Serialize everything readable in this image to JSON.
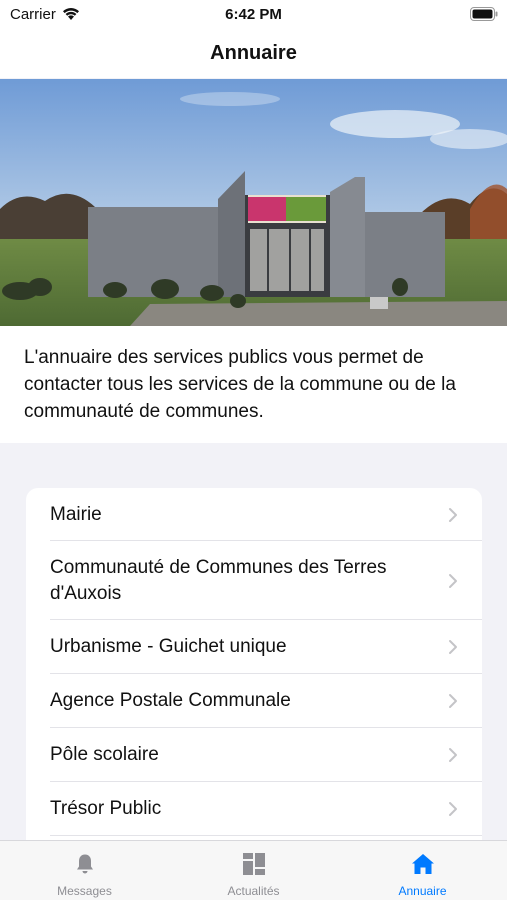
{
  "status_bar": {
    "carrier": "Carrier",
    "time": "6:42 PM"
  },
  "nav": {
    "title": "Annuaire"
  },
  "intro": {
    "text": "L'annuaire des services publics vous permet de contacter tous les services de la commune ou de la communauté de communes."
  },
  "directory": {
    "items": [
      {
        "label": "Mairie"
      },
      {
        "label": "Communauté de Communes des Terres d'Auxois"
      },
      {
        "label": "Urbanisme - Guichet unique"
      },
      {
        "label": "Agence Postale Communale"
      },
      {
        "label": "Pôle scolaire"
      },
      {
        "label": "Trésor Public"
      }
    ]
  },
  "tab_bar": {
    "tabs": [
      {
        "label": "Messages",
        "icon": "bell-icon"
      },
      {
        "label": "Actualités",
        "icon": "grid-icon"
      },
      {
        "label": "Annuaire",
        "icon": "home-icon",
        "active": true
      }
    ]
  },
  "colors": {
    "accent": "#007aff",
    "inactive": "#8e8e93",
    "background": "#f2f2f7"
  }
}
